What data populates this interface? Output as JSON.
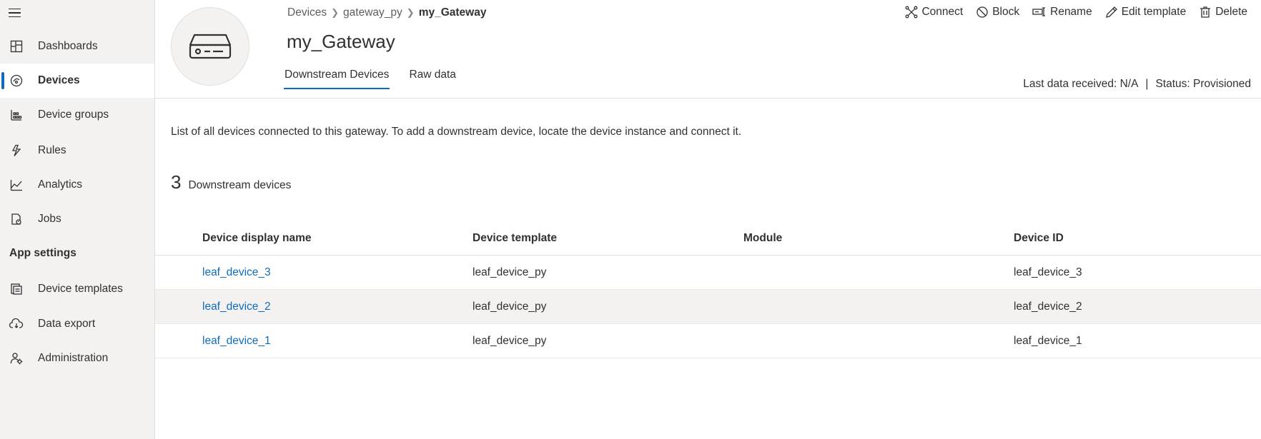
{
  "sidebar": {
    "items": [
      {
        "label": "Dashboards",
        "icon": "dashboard-icon"
      },
      {
        "label": "Devices",
        "icon": "devices-icon"
      },
      {
        "label": "Device groups",
        "icon": "device-groups-icon"
      },
      {
        "label": "Rules",
        "icon": "rules-icon"
      },
      {
        "label": "Analytics",
        "icon": "analytics-icon"
      },
      {
        "label": "Jobs",
        "icon": "jobs-icon"
      }
    ],
    "section_label": "App settings",
    "settings_items": [
      {
        "label": "Device templates",
        "icon": "device-templates-icon"
      },
      {
        "label": "Data export",
        "icon": "data-export-icon"
      },
      {
        "label": "Administration",
        "icon": "administration-icon"
      }
    ]
  },
  "breadcrumb": [
    "Devices",
    "gateway_py",
    "my_Gateway"
  ],
  "header": {
    "title": "my_Gateway",
    "tabs": [
      "Downstream Devices",
      "Raw data"
    ],
    "last_data": "Last data received: N/A",
    "separator": "|",
    "status": "Status: Provisioned"
  },
  "toolbar": {
    "connect": "Connect",
    "block": "Block",
    "rename": "Rename",
    "edit_template": "Edit template",
    "delete": "Delete"
  },
  "content": {
    "description": "List of all devices connected to this gateway. To add a downstream device, locate the device instance and connect it.",
    "count": "3",
    "count_label": "Downstream devices"
  },
  "table": {
    "columns": [
      "Device display name",
      "Device template",
      "Module",
      "Device ID"
    ],
    "rows": [
      {
        "name": "leaf_device_3",
        "template": "leaf_device_py",
        "module": "",
        "id": "leaf_device_3"
      },
      {
        "name": "leaf_device_2",
        "template": "leaf_device_py",
        "module": "",
        "id": "leaf_device_2"
      },
      {
        "name": "leaf_device_1",
        "template": "leaf_device_py",
        "module": "",
        "id": "leaf_device_1"
      }
    ]
  },
  "colors": {
    "accent": "#0f6cbd",
    "sidebar_bg": "#f3f2f1",
    "row_hover": "#f3f2f1"
  }
}
